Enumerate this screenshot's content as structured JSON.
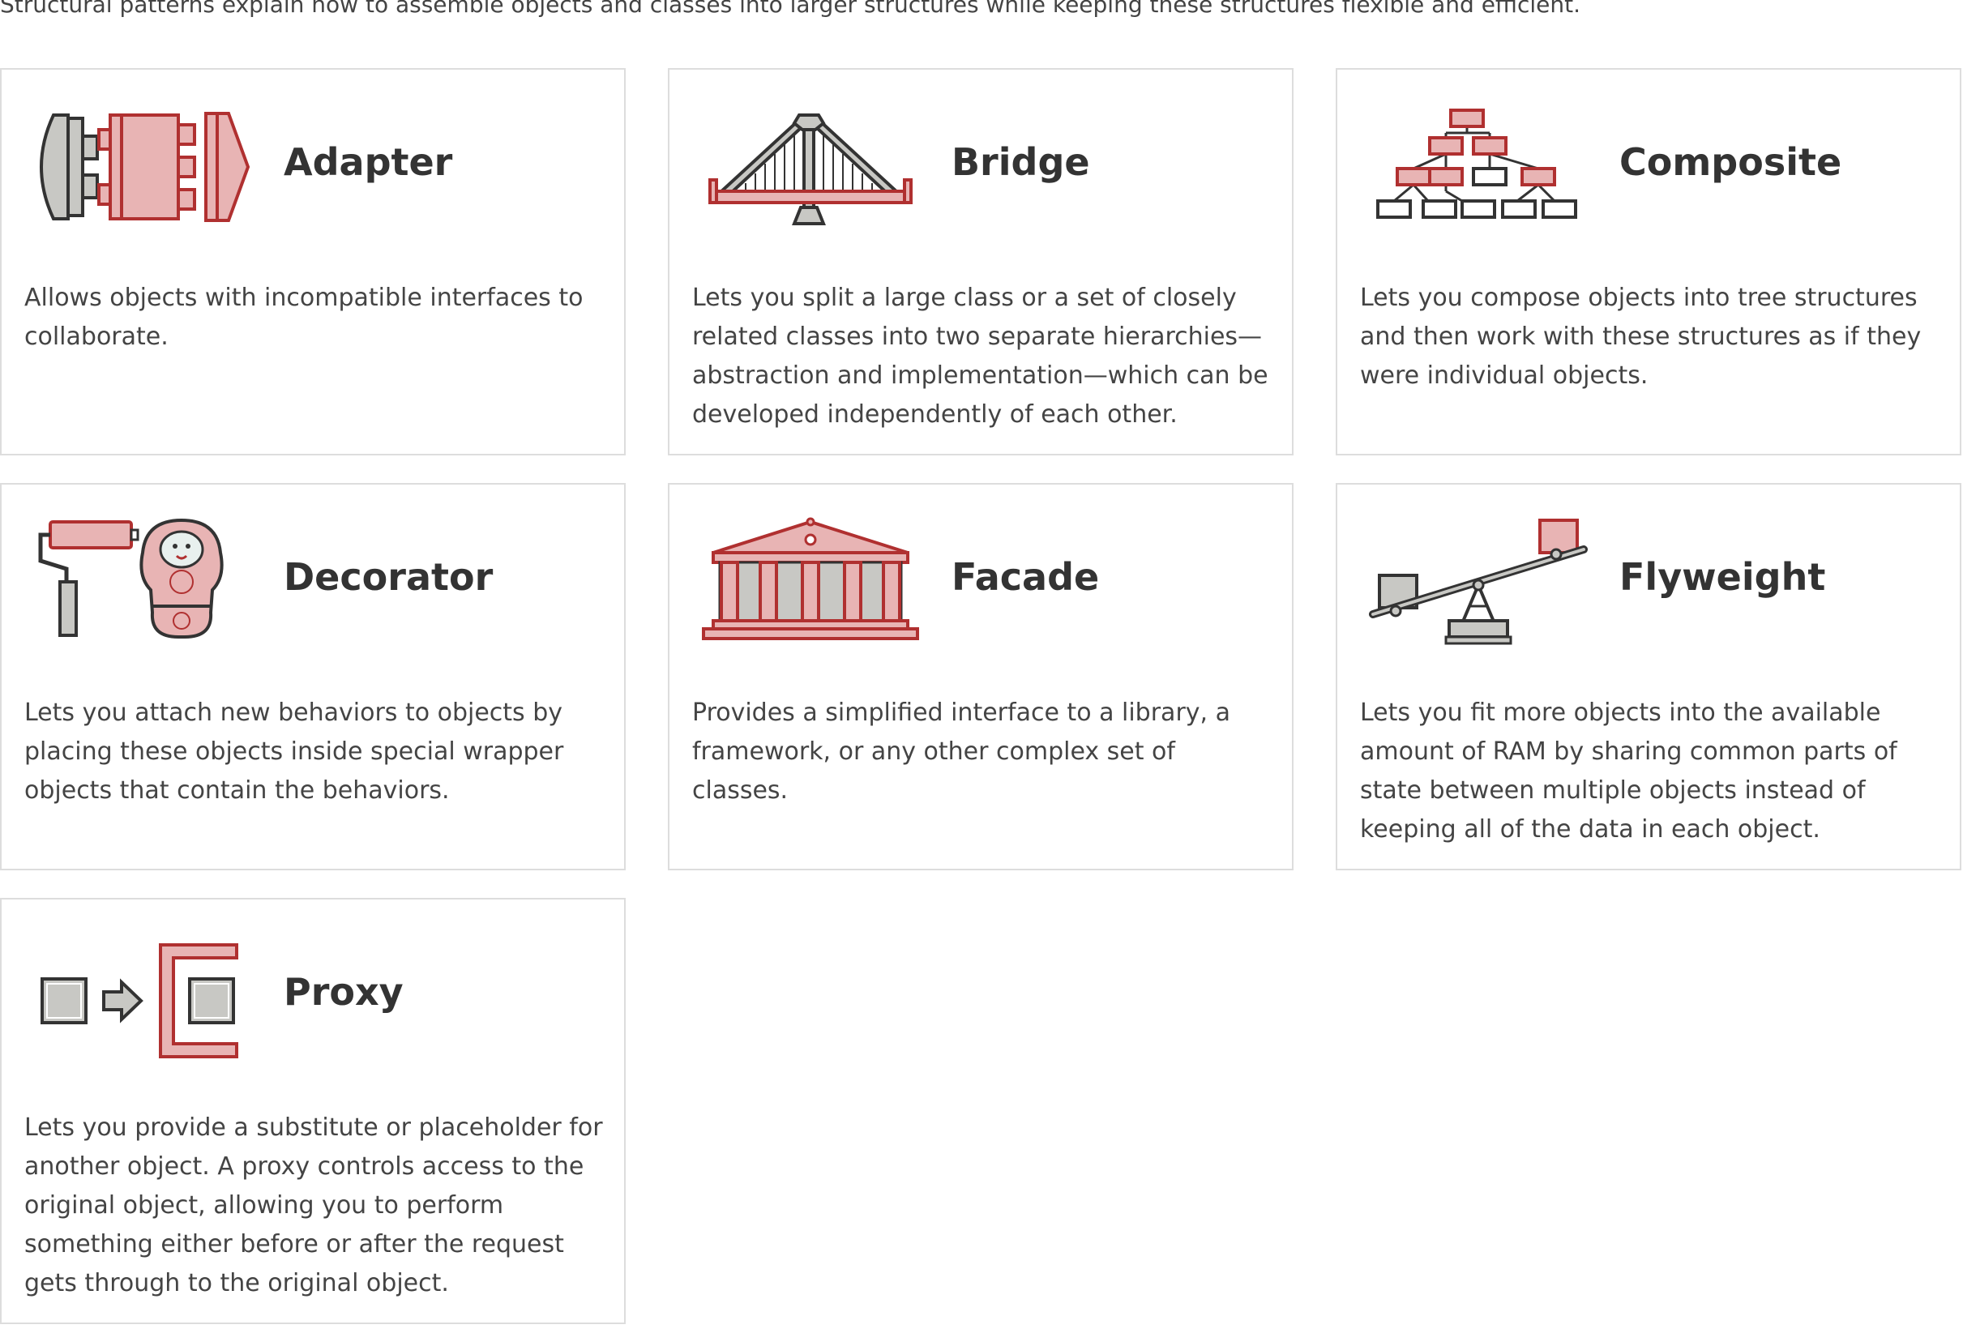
{
  "intro": "Structural patterns explain how to assemble objects and classes into larger structures while keeping these structures flexible and efficient.",
  "patterns": [
    {
      "name": "Adapter",
      "icon": "adapter-icon",
      "description": "Allows objects with incompatible interfaces to collaborate."
    },
    {
      "name": "Bridge",
      "icon": "bridge-icon",
      "description": "Lets you split a large class or a set of closely related classes into two separate hierarchies—abstraction and implementation—which can be developed independently of each other."
    },
    {
      "name": "Composite",
      "icon": "composite-tree-icon",
      "description": "Lets you compose objects into tree structures and then work with these structures as if they were individual objects."
    },
    {
      "name": "Decorator",
      "icon": "decorator-icon",
      "description": "Lets you attach new behaviors to objects by placing these objects inside special wrapper objects that contain the behaviors."
    },
    {
      "name": "Facade",
      "icon": "facade-building-icon",
      "description": "Provides a simplified interface to a library, a framework, or any other complex set of classes."
    },
    {
      "name": "Flyweight",
      "icon": "flyweight-seesaw-icon",
      "description": "Lets you fit more objects into the available amount of RAM by sharing common parts of state between multiple objects instead of keeping all of the data in each object."
    },
    {
      "name": "Proxy",
      "icon": "proxy-icon",
      "description": "Lets you provide a substitute or placeholder for another object. A proxy controls access to the original object, allowing you to perform something either before or after the request gets through to the original object."
    }
  ],
  "colors": {
    "accent_red": "#c0392b",
    "accent_pink": "#e8b4b4",
    "icon_gray": "#c8c8c4",
    "outline": "#333333",
    "card_border": "#dddddd",
    "text": "#444444"
  }
}
